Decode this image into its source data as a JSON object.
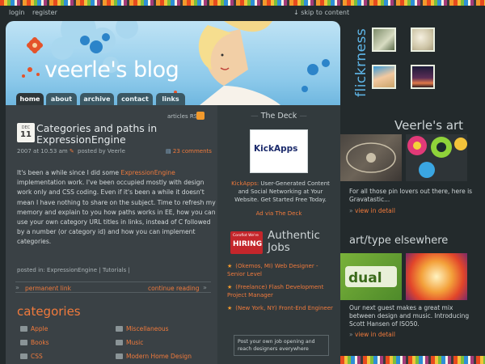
{
  "utility": {
    "login": "login",
    "register": "register",
    "skip": "skip to content"
  },
  "header": {
    "title": "veerle's blog"
  },
  "nav": {
    "items": [
      {
        "label": "home"
      },
      {
        "label": "about"
      },
      {
        "label": "archive"
      },
      {
        "label": "contact"
      },
      {
        "label": "links"
      }
    ],
    "active": "home"
  },
  "post": {
    "rss_label": "articles RSS",
    "date_month": "DEC",
    "date_day": "11",
    "title": "Categories and paths in ExpressionEngine",
    "meta_date": "2007 at 10.53 am",
    "meta_author": "posted by Veerle",
    "comments": "23 comments",
    "body_before_link": "It's been a while since I did some ",
    "body_link": "ExpressionEngine",
    "body_after_link": " implementation work. I've been occupied mostly with design work only and CSS coding. Even if it's been a while it doesn't mean I have nothing to share on the subject. Time to refresh my memory and explain to you how paths works in EE, how you can use your own category URL titles in links, instead of C followed by a number (or category id) and how you can implement categories.",
    "posted_in": "posted in: ExpressionEngine | Tutorials |",
    "permanent_link": "permanent link",
    "continue_reading": "continue reading"
  },
  "categories": {
    "heading": "categories",
    "left": [
      "Apple",
      "Books",
      "CSS"
    ],
    "right": [
      "Miscellaneous",
      "Music",
      "Modern Home Design"
    ]
  },
  "deck": {
    "title": "The Deck",
    "ad_brand": "KickApps",
    "ad_text_highlight": "KickApps:",
    "ad_text": " User-Generated Content and Social Networking at Your Website. Get Started Free Today.",
    "via": "Ad via The Deck"
  },
  "jobs": {
    "logo_top": "Coroflot We're",
    "logo_main": "HIRING",
    "title": "Authentic Jobs",
    "items": [
      "(Okemos, MI) Web Designer - Senior Level",
      "(Freelance) Flash Development Project Manager",
      "(New York, NY) Front-End Engineer"
    ],
    "post_box": "Post your own job opening and reach designers everywhere"
  },
  "flickr": {
    "label": "flickrness"
  },
  "art": {
    "heading": "Veerle's art",
    "desc": "For all those pin lovers out there, here is Gravatastic...",
    "link": "view in detail"
  },
  "arttype": {
    "heading": "art/type elsewhere",
    "desc": "Our next guest makes a great mix between design and music. Introducing Scott Hansen of ISO50.",
    "link": "view in detail"
  },
  "colors": {
    "accent": "#f07a3c",
    "background": "#232a2c",
    "content_bg": "#3a4145",
    "header_blue": "#8cc9ea"
  }
}
